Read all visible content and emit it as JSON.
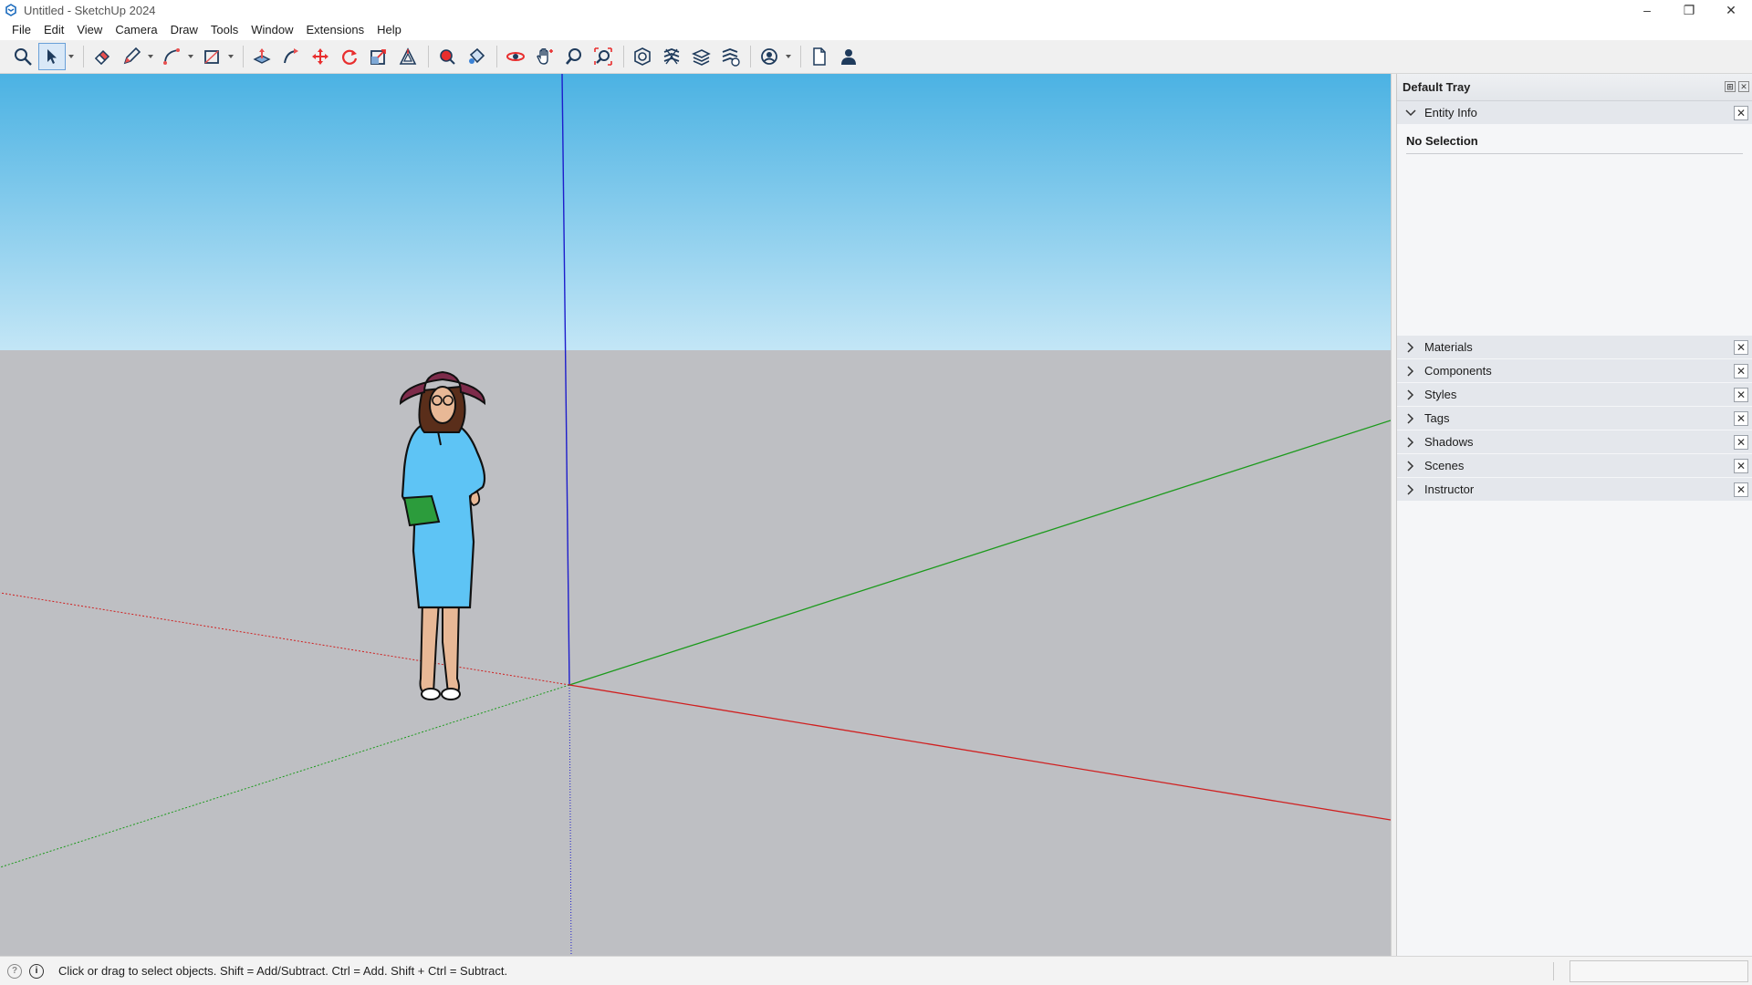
{
  "window": {
    "title": "Untitled - SketchUp 2024",
    "minimize": "–",
    "maximize": "❐",
    "close": "✕"
  },
  "menu": [
    "File",
    "Edit",
    "View",
    "Camera",
    "Draw",
    "Tools",
    "Window",
    "Extensions",
    "Help"
  ],
  "toolbar": {
    "tools": [
      "search-icon",
      "select-icon",
      "eraser-icon",
      "pencil-icon",
      "arc-icon",
      "rectangle-icon",
      "push-pull-icon",
      "follow-me-icon",
      "move-icon",
      "rotate-icon",
      "scale-icon",
      "offset-icon",
      "tape-measure-icon",
      "paint-bucket-icon",
      "orbit-icon",
      "pan-icon",
      "zoom-icon",
      "zoom-extents-icon",
      "section-plane-icon",
      "3d-warehouse-icon",
      "extension-warehouse-icon",
      "layout-icon",
      "account-icon",
      "new-file-icon",
      "profile-icon"
    ]
  },
  "viewport": {
    "sky_color": "#4bb2e3",
    "ground_color": "#bebfc3",
    "axis_colors": {
      "x": "#d01f1f",
      "y": "#1c9a1c",
      "z": "#1d1dcc"
    },
    "scale_figure": "woman-figure"
  },
  "tray": {
    "title": "Default Tray",
    "pin": "⊞",
    "close": "✕",
    "entity_info": {
      "label": "Entity Info",
      "close": "✕",
      "selection": "No Selection"
    },
    "panels": [
      {
        "label": "Materials",
        "close": "✕"
      },
      {
        "label": "Components",
        "close": "✕"
      },
      {
        "label": "Styles",
        "close": "✕"
      },
      {
        "label": "Tags",
        "close": "✕"
      },
      {
        "label": "Shadows",
        "close": "✕"
      },
      {
        "label": "Scenes",
        "close": "✕"
      },
      {
        "label": "Instructor",
        "close": "✕"
      }
    ]
  },
  "statusbar": {
    "geo_icon": "?",
    "info_icon": "i",
    "text": "Click or drag to select objects. Shift = Add/Subtract. Ctrl = Add. Shift + Ctrl = Subtract.",
    "measurements": ""
  }
}
